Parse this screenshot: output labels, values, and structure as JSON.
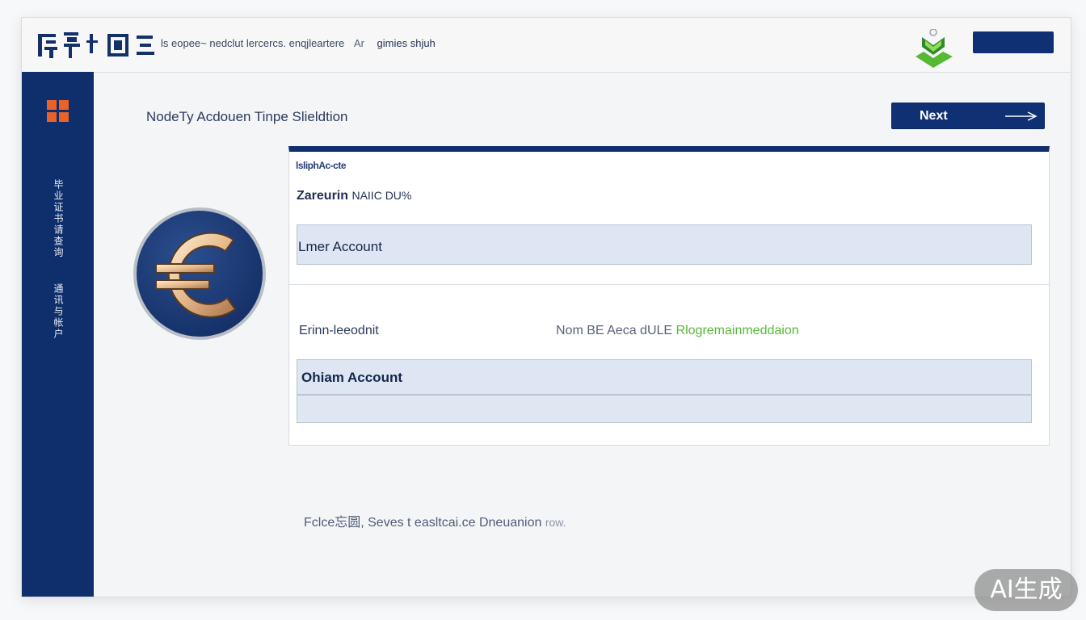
{
  "header": {
    "logo_text": "chinese-seal-logo",
    "tagline_main": "ls eopee~ nedclut lercercs. enqjleartere",
    "tagline_mid": "Ar",
    "tagline_strong": "gimies shjuh",
    "brand_icon": "shield-chevron-icon",
    "brand_color": "#55b934",
    "accent_color": "#0f3072"
  },
  "sidebar": {
    "logo_icon": "windows-grid-icon",
    "logo_color": "#e8622a",
    "vertical_text_1": "毕业证书请查询",
    "vertical_text_2": "通讯与帐户"
  },
  "main": {
    "title": "NodeTy Acdouen Tinpe Slieldtion",
    "next_label": "Next",
    "coin_icon": "euro-coin-icon"
  },
  "card1": {
    "tiny_label": "lsliphAc-cte",
    "sub_label_bold": "Zareurin",
    "sub_label_thin": "NAIIC DU%",
    "option_label": "Lmer Account"
  },
  "card2": {
    "left_label": "Erinn-leeodnit",
    "right_label": "Nom BE Aeca dULE",
    "right_label_green": "Rlogremainmeddaion",
    "option_label": "Ohiam Account",
    "empty_option": ""
  },
  "footer": {
    "text": "Fclce忘圆, Seves t easltcai.ce Dneuanion",
    "faint": "row."
  },
  "watermark": {
    "text": "AI生成"
  }
}
